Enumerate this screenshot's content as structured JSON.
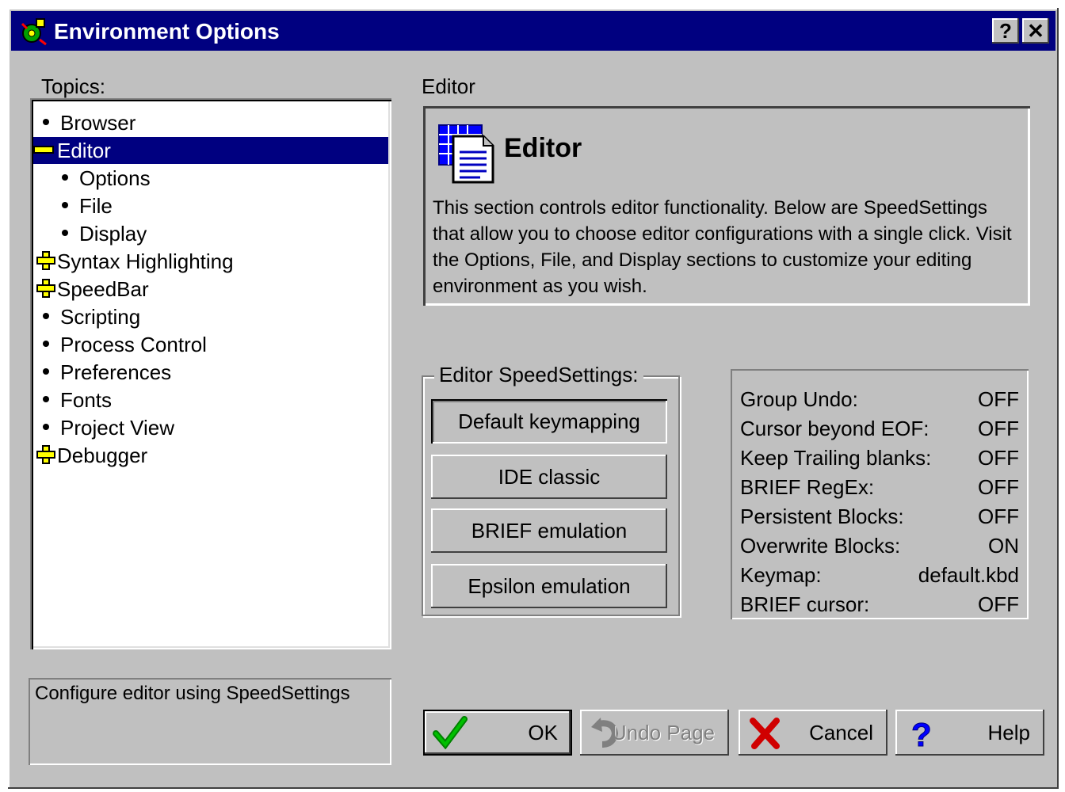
{
  "window": {
    "title": "Environment Options",
    "help_btn": "?",
    "close_btn": "✕"
  },
  "topics": {
    "label": "Topics:",
    "items": [
      {
        "label": "Browser",
        "marker": "bullet",
        "indent": 0
      },
      {
        "label": "Editor",
        "marker": "minus",
        "indent": 0,
        "selected": true
      },
      {
        "label": "Options",
        "marker": "bullet",
        "indent": 1
      },
      {
        "label": "File",
        "marker": "bullet",
        "indent": 1
      },
      {
        "label": "Display",
        "marker": "bullet",
        "indent": 1
      },
      {
        "label": "Syntax Highlighting",
        "marker": "plus",
        "indent": 0
      },
      {
        "label": "SpeedBar",
        "marker": "plus",
        "indent": 0
      },
      {
        "label": "Scripting",
        "marker": "bullet",
        "indent": 0
      },
      {
        "label": "Process Control",
        "marker": "bullet",
        "indent": 0
      },
      {
        "label": "Preferences",
        "marker": "bullet",
        "indent": 0
      },
      {
        "label": "Fonts",
        "marker": "bullet",
        "indent": 0
      },
      {
        "label": "Project View",
        "marker": "bullet",
        "indent": 0
      },
      {
        "label": "Debugger",
        "marker": "plus",
        "indent": 0
      }
    ]
  },
  "section": {
    "label": "Editor",
    "heading": "Editor",
    "description": "This section controls editor functionality. Below are SpeedSettings that allow you to choose editor configurations with a single click. Visit the Options, File, and Display sections to customize your editing environment as you wish."
  },
  "speedsettings": {
    "label": "Editor SpeedSettings:",
    "buttons": [
      "Default keymapping",
      "IDE classic",
      "BRIEF emulation",
      "Epsilon emulation"
    ]
  },
  "status": [
    {
      "key": "Group Undo:",
      "value": "OFF"
    },
    {
      "key": "Cursor beyond EOF:",
      "value": "OFF"
    },
    {
      "key": "Keep Trailing blanks:",
      "value": "OFF"
    },
    {
      "key": "BRIEF RegEx:",
      "value": "OFF"
    },
    {
      "key": "Persistent Blocks:",
      "value": "OFF"
    },
    {
      "key": "Overwrite Blocks:",
      "value": "ON"
    },
    {
      "key": "Keymap:",
      "value": "default.kbd"
    },
    {
      "key": "BRIEF cursor:",
      "value": "OFF"
    }
  ],
  "hint": "Configure editor using SpeedSettings",
  "buttons": {
    "ok": "OK",
    "undo": "Undo Page",
    "cancel": "Cancel",
    "help": "Help"
  },
  "colors": {
    "title_bar": "#000080",
    "face": "#c0c0c0",
    "selection": "#000080"
  }
}
